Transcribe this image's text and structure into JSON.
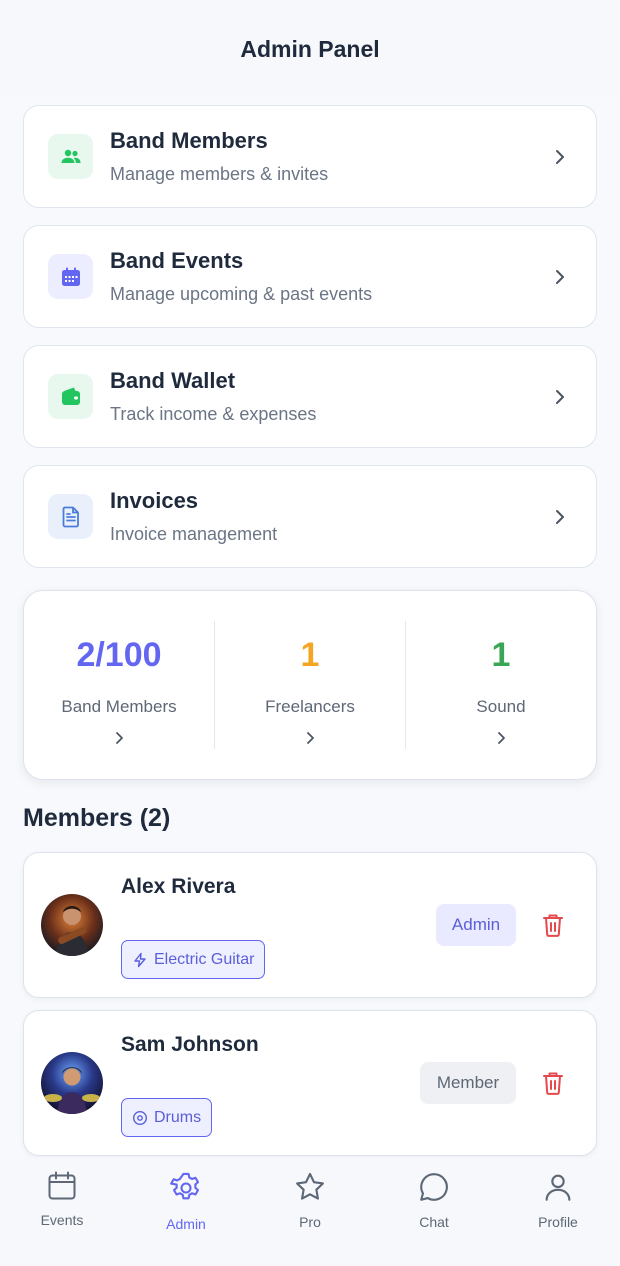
{
  "header": {
    "title": "Admin Panel"
  },
  "menu": [
    {
      "title": "Band Members",
      "subtitle": "Manage members & invites",
      "icon": "users-icon",
      "color": "#22c55e",
      "bg": "#e8f8ee"
    },
    {
      "title": "Band Events",
      "subtitle": "Manage upcoming & past events",
      "icon": "calendar-icon",
      "color": "#6366f1",
      "bg": "#eceeff"
    },
    {
      "title": "Band Wallet",
      "subtitle": "Track income & expenses",
      "icon": "wallet-icon",
      "color": "#22c55e",
      "bg": "#e8f8ee"
    },
    {
      "title": "Invoices",
      "subtitle": "Invoice management",
      "icon": "document-icon",
      "color": "#4a7dd9",
      "bg": "#e9f0fc"
    }
  ],
  "stats": [
    {
      "value": "2/100",
      "label": "Band Members",
      "color": "#6366f1"
    },
    {
      "value": "1",
      "label": "Freelancers",
      "color": "#f5a524"
    },
    {
      "value": "1",
      "label": "Sound",
      "color": "#3aa655"
    }
  ],
  "members": {
    "title": "Members (2)",
    "list": [
      {
        "name": "Alex Rivera",
        "instrument": "Electric Guitar",
        "instrument_icon": "lightning-icon",
        "role": "Admin"
      },
      {
        "name": "Sam Johnson",
        "instrument": "Drums",
        "instrument_icon": "disc-icon",
        "role": "Member"
      }
    ]
  },
  "tabs": [
    {
      "label": "Events",
      "icon": "calendar-icon",
      "active": false
    },
    {
      "label": "Admin",
      "icon": "gear-icon",
      "active": true
    },
    {
      "label": "Pro",
      "icon": "star-icon",
      "active": false
    },
    {
      "label": "Chat",
      "icon": "chat-icon",
      "active": false
    },
    {
      "label": "Profile",
      "icon": "person-icon",
      "active": false
    }
  ],
  "colors": {
    "accent": "#6366f1",
    "danger": "#e5484d",
    "text": "#1f2a3d",
    "muted": "#6b7585"
  }
}
